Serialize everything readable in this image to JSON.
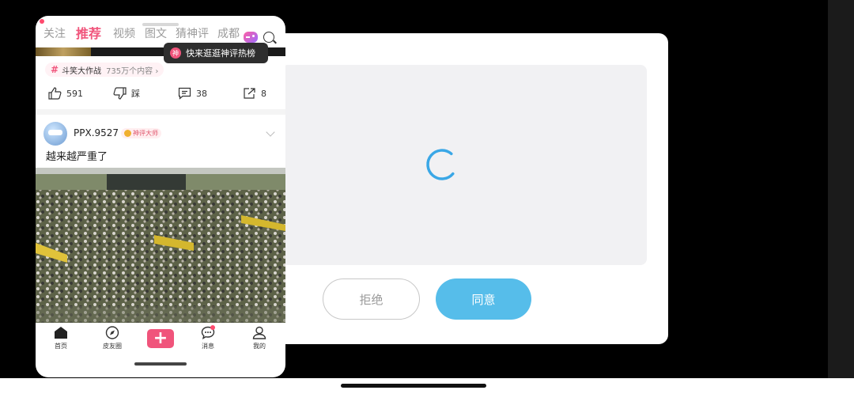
{
  "top_tabs": {
    "follow": "关注",
    "recommend": "推荐",
    "video": "视频",
    "image_text": "图文",
    "guess_comment": "猜神评",
    "city": "成都"
  },
  "tooltip": {
    "badge": "神",
    "text": "快来逛逛神评热榜"
  },
  "tag": {
    "hash": "#",
    "name": "斗笑大作战",
    "count": "735万个内容 ›"
  },
  "actions": {
    "like": "591",
    "dislike": "踩",
    "comment": "38",
    "share": "8"
  },
  "post": {
    "username": "PPX.9527",
    "badge": "神评大师",
    "text": "越来越严重了"
  },
  "bottom_nav": {
    "home": "首页",
    "circle": "皮友圈",
    "plus": "+",
    "messages": "消息",
    "me": "我的"
  },
  "dialog": {
    "reject": "拒绝",
    "agree": "同意"
  },
  "colors": {
    "accent": "#f0547b",
    "agree_button": "#56bdea",
    "spinner": "#3aa7e6"
  }
}
